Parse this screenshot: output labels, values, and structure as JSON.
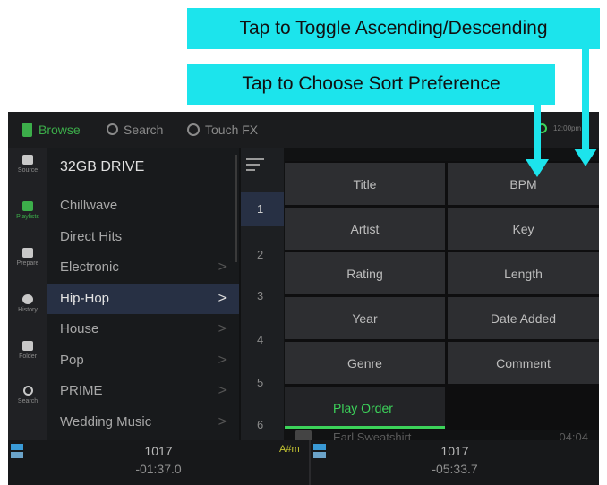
{
  "callouts": {
    "toggle": "Tap to Toggle Ascending/Descending",
    "sort": "Tap to Choose Sort Preference"
  },
  "topbar": {
    "browse": "Browse",
    "search": "Search",
    "touchfx": "Touch FX",
    "clock": "12:00pm"
  },
  "rail": [
    {
      "label": "Source"
    },
    {
      "label": "Playlists"
    },
    {
      "label": "Prepare"
    },
    {
      "label": "History"
    },
    {
      "label": "Folder"
    },
    {
      "label": "Search"
    }
  ],
  "crates": {
    "title": "32GB DRIVE",
    "items": [
      "Chillwave",
      "Direct Hits",
      "Electronic",
      "Hip-Hop",
      "House",
      "Pop",
      "PRIME",
      "Wedding Music"
    ],
    "chevron": ">"
  },
  "numbers": [
    "1",
    "2",
    "3",
    "4",
    "5",
    "6"
  ],
  "sort_options": {
    "left": [
      "Title",
      "Artist",
      "Rating",
      "Year",
      "Genre",
      "Play Order"
    ],
    "right": [
      "BPM",
      "Key",
      "Length",
      "Date Added",
      "Comment"
    ]
  },
  "ghost_row": {
    "artist": "Earl Sweatshirt",
    "length": "04:04"
  },
  "decks": {
    "left": {
      "bpm": "1017",
      "time": "-01:37.0"
    },
    "right": {
      "bpm": "1017",
      "time": "-05:33.7"
    },
    "key": "A#m"
  },
  "colors": {
    "accent_green": "#3cd35a",
    "callout": "#1ce4ec",
    "selection": "#273044"
  }
}
